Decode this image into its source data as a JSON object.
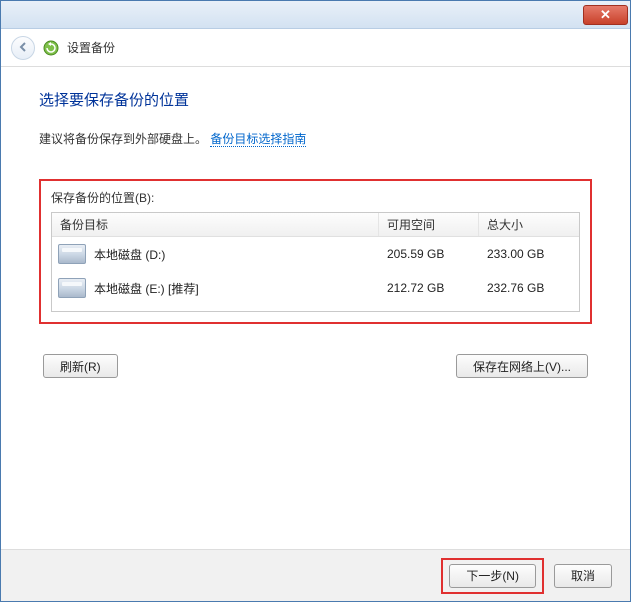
{
  "window": {
    "close_symbol": "✕"
  },
  "header": {
    "breadcrumb": "设置备份"
  },
  "main": {
    "heading": "选择要保存备份的位置",
    "hint_text": "建议将备份保存到外部硬盘上。",
    "hint_link": "备份目标选择指南",
    "list_label": "保存备份的位置(B):",
    "columns": {
      "name": "备份目标",
      "free": "可用空间",
      "total": "总大小"
    },
    "drives": [
      {
        "name": "本地磁盘 (D:)",
        "free": "205.59 GB",
        "total": "233.00 GB"
      },
      {
        "name": "本地磁盘 (E:) [推荐]",
        "free": "212.72 GB",
        "total": "232.76 GB"
      }
    ],
    "refresh_label": "刷新(R)",
    "network_label": "保存在网络上(V)..."
  },
  "footer": {
    "next_label": "下一步(N)",
    "cancel_label": "取消"
  }
}
